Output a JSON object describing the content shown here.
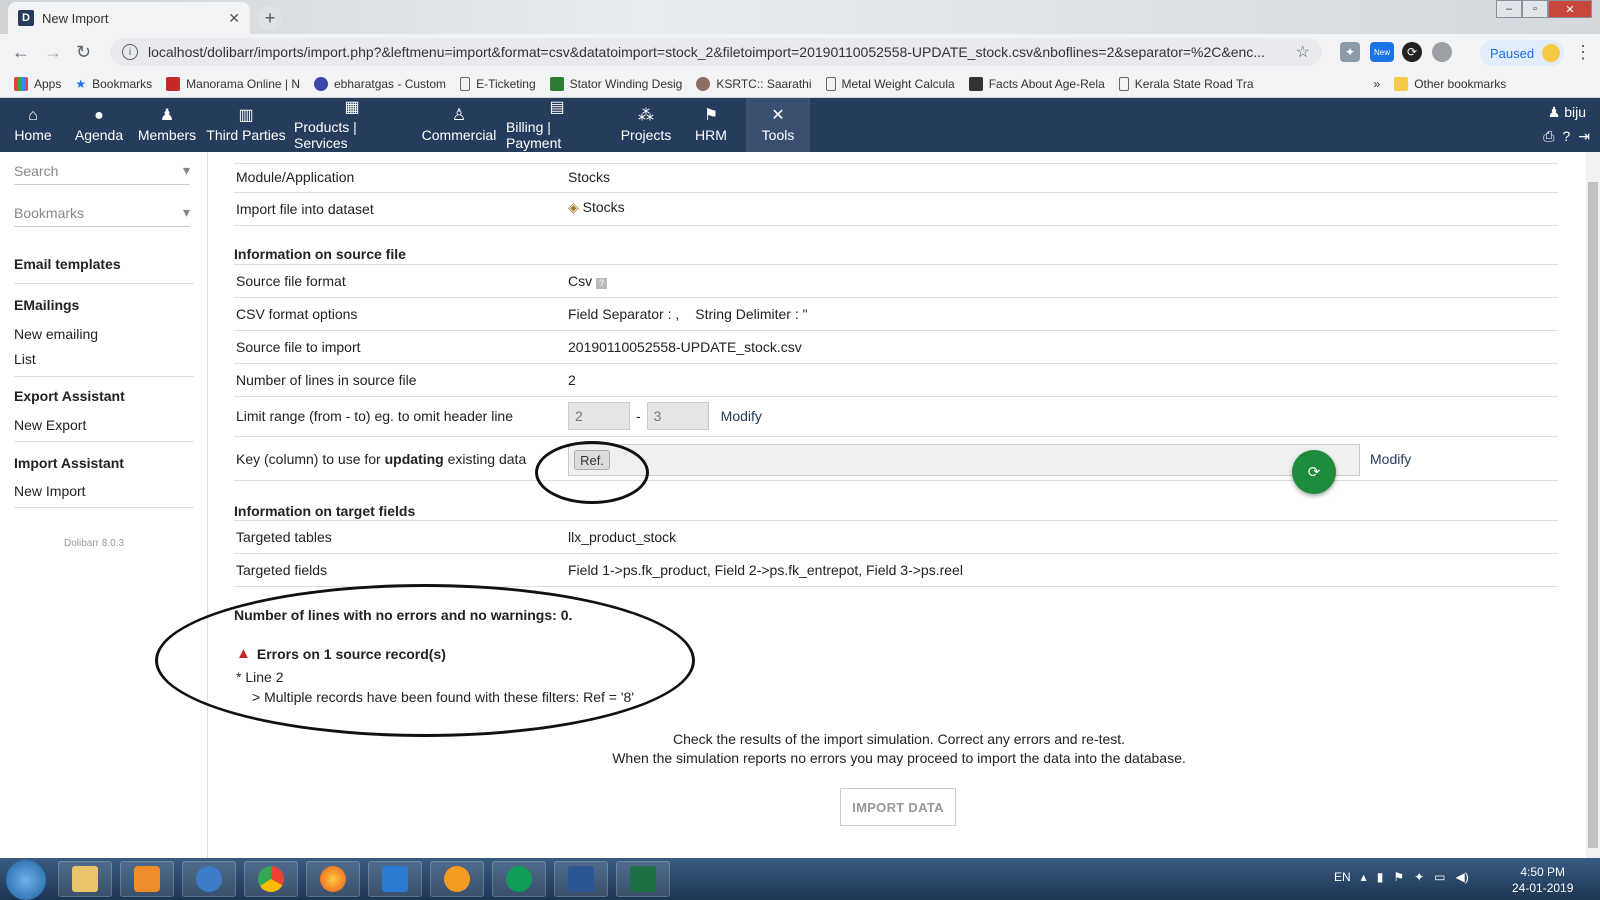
{
  "browser": {
    "tab_title": "New Import",
    "tab_favicon": "D",
    "url": "localhost/dolibarr/imports/import.php?&leftmenu=import&format=csv&datatoimport=stock_2&filetoimport=20190110052558-UPDATE_stock.csv&nboflines=2&separator=%2C&enc...",
    "paused_label": "Paused",
    "new_badge": "New",
    "bookmarks": [
      "Apps",
      "Bookmarks",
      "Manorama Online | N",
      "ebharatgas - Custom",
      "E-Ticketing",
      "Stator Winding Desig",
      "KSRTC:: Saarathi",
      "Metal Weight Calcula",
      "Facts About Age-Rela",
      "Kerala State Road Tra"
    ],
    "more_bookmarks": "»",
    "other_bookmarks": "Other bookmarks"
  },
  "topmenu": {
    "items": [
      "Home",
      "Agenda",
      "Members",
      "Third Parties",
      "Products | Services",
      "Commercial",
      "Billing | Payment",
      "Projects",
      "HRM",
      "Tools"
    ],
    "active": "Tools",
    "user": "biju"
  },
  "sidebar": {
    "search_placeholder": "Search",
    "bookmarks_placeholder": "Bookmarks",
    "email_templates": "Email templates",
    "emailings_head": "EMailings",
    "new_emailing": "New emailing",
    "list": "List",
    "export_head": "Export Assistant",
    "new_export": "New Export",
    "import_head": "Import Assistant",
    "new_import": "New Import",
    "version": "Dolibarr 8.0.3"
  },
  "main": {
    "module_label": "Module/Application",
    "module_value": "Stocks",
    "dataset_label": "Import file into dataset",
    "dataset_value": "Stocks",
    "source_section": "Information on source file",
    "format_label": "Source file format",
    "format_value": "Csv",
    "csv_label": "CSV format options",
    "csv_value": "Field Separator : ,",
    "csv_value2": "String Delimiter : \"",
    "file_label": "Source file to import",
    "file_value": "20190110052558-UPDATE_stock.csv",
    "lines_label": "Number of lines in source file",
    "lines_value": "2",
    "range_label": "Limit range (from - to) eg. to omit header line",
    "range_from": "2",
    "range_sep": "-",
    "range_to": "3",
    "modify": "Modify",
    "key_label_pre": "Key (column) to use for",
    "key_label_bold": "updating",
    "key_label_post": "existing data",
    "key_value": "Ref.",
    "target_section": "Information on target fields",
    "tables_label": "Targeted tables",
    "tables_value": "llx_product_stock",
    "fields_label": "Targeted fields",
    "fields_value": "Field 1->ps.fk_product, Field 2->ps.fk_entrepot, Field 3->ps.reel",
    "no_errors_line": "Number of lines with no errors and no warnings: 0.",
    "errors_title": "Errors on 1 source record(s)",
    "error_line": "* Line 2",
    "error_detail": "> Multiple records have been found with these filters: Ref = '8'",
    "info1": "Check the results of the import simulation. Correct any errors and re-test.",
    "info2": "When the simulation reports no errors you may proceed to import the data into the database.",
    "import_button": "IMPORT DATA"
  },
  "taskbar": {
    "lang": "EN",
    "time": "4:50 PM",
    "date": "24-01-2019"
  }
}
